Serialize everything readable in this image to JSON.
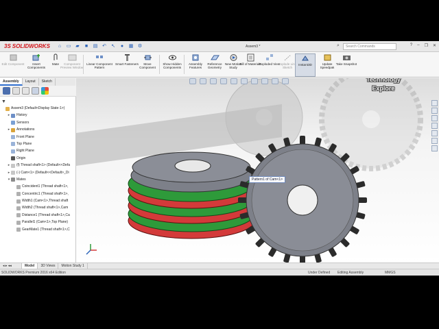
{
  "app": {
    "brand": "SOLIDWORKS",
    "document_title": "Assem3 *",
    "search_placeholder": "Search Commands"
  },
  "commands": [
    {
      "label": "Edit Component",
      "enabled": false
    },
    {
      "label": "Insert Components",
      "enabled": true
    },
    {
      "label": "Mate",
      "enabled": true
    },
    {
      "label": "Component Preview Window",
      "enabled": false
    },
    {
      "label": "Linear Component Pattern",
      "enabled": true
    },
    {
      "label": "Smart Fasteners",
      "enabled": true
    },
    {
      "label": "Move Component",
      "enabled": true
    },
    {
      "label": "Show Hidden Components",
      "enabled": true
    },
    {
      "label": "Assembly Features",
      "enabled": true
    },
    {
      "label": "Reference Geometry",
      "enabled": true
    },
    {
      "label": "New Motion Study",
      "enabled": true
    },
    {
      "label": "Bill of Materials",
      "enabled": true
    },
    {
      "label": "Exploded View",
      "enabled": true
    },
    {
      "label": "Explode Line Sketch",
      "enabled": false
    },
    {
      "label": "Instant3D",
      "enabled": true,
      "active": true
    },
    {
      "label": "Update Speedpak",
      "enabled": true
    },
    {
      "label": "Take Snapshot",
      "enabled": true
    }
  ],
  "panel_tabs": [
    "Assembly",
    "Layout",
    "Sketch"
  ],
  "tree": [
    {
      "label": "Assem3  (Default<Display State-1>)",
      "indent": 0,
      "expander": "",
      "icon": "assembly-icon"
    },
    {
      "label": "History",
      "indent": 1,
      "expander": "▸",
      "icon": "history-icon"
    },
    {
      "label": "Sensors",
      "indent": 1,
      "expander": "",
      "icon": "sensor-icon"
    },
    {
      "label": "Annotations",
      "indent": 1,
      "expander": "▸",
      "icon": "annotation-icon"
    },
    {
      "label": "Front Plane",
      "indent": 1,
      "expander": "",
      "icon": "plane-icon"
    },
    {
      "label": "Top Plane",
      "indent": 1,
      "expander": "",
      "icon": "plane-icon"
    },
    {
      "label": "Right Plane",
      "indent": 1,
      "expander": "",
      "icon": "plane-icon"
    },
    {
      "label": "Origin",
      "indent": 1,
      "expander": "",
      "icon": "origin-icon"
    },
    {
      "label": "(f) Thread shaft<1> (Default<<Defa",
      "indent": 1,
      "expander": "▸",
      "icon": "part-icon"
    },
    {
      "label": "(-) Cam<1> (Default<<Default>_Di",
      "indent": 1,
      "expander": "▸",
      "icon": "part-icon"
    },
    {
      "label": "Mates",
      "indent": 1,
      "expander": "▾",
      "icon": "mates-icon"
    },
    {
      "label": "Coincident1 (Thread shaft<1>,",
      "indent": 2,
      "expander": "",
      "icon": "mate-icon"
    },
    {
      "label": "Concentric1 (Thread shaft<1>,",
      "indent": 2,
      "expander": "",
      "icon": "mate-icon"
    },
    {
      "label": "Width1 (Cam<1>,Thread shaft",
      "indent": 2,
      "expander": "",
      "icon": "mate-icon"
    },
    {
      "label": "Width2 (Thread shaft<1>,Cam",
      "indent": 2,
      "expander": "",
      "icon": "mate-icon"
    },
    {
      "label": "Distance1 (Thread shaft<1>,Ca",
      "indent": 2,
      "expander": "",
      "icon": "mate-icon"
    },
    {
      "label": "Parallel1 (Cam<1>,Top Plane)",
      "indent": 2,
      "expander": "",
      "icon": "mate-icon"
    },
    {
      "label": "GearMate1 (Thread shaft<1>,C",
      "indent": 2,
      "expander": "",
      "icon": "mate-icon"
    }
  ],
  "viewport": {
    "tooltip": "Pattern1 of Cam<1>",
    "watermark_line1": "Technology",
    "watermark_line2": "Explore"
  },
  "bottom_tabs": [
    "Model",
    "3D Views",
    "Motion Study 1"
  ],
  "status": {
    "edition": "SOLIDWORKS Premium 2016 x64 Edition",
    "definition": "Under Defined",
    "mode": "Editing Assembly",
    "units": "MMGS"
  },
  "colors": {
    "brand_red": "#d3141a",
    "gear_gray": "#7d8089",
    "thread_red": "#d33a3a",
    "thread_green": "#2e9a3a",
    "selection_blue": "#2f6fcf"
  }
}
